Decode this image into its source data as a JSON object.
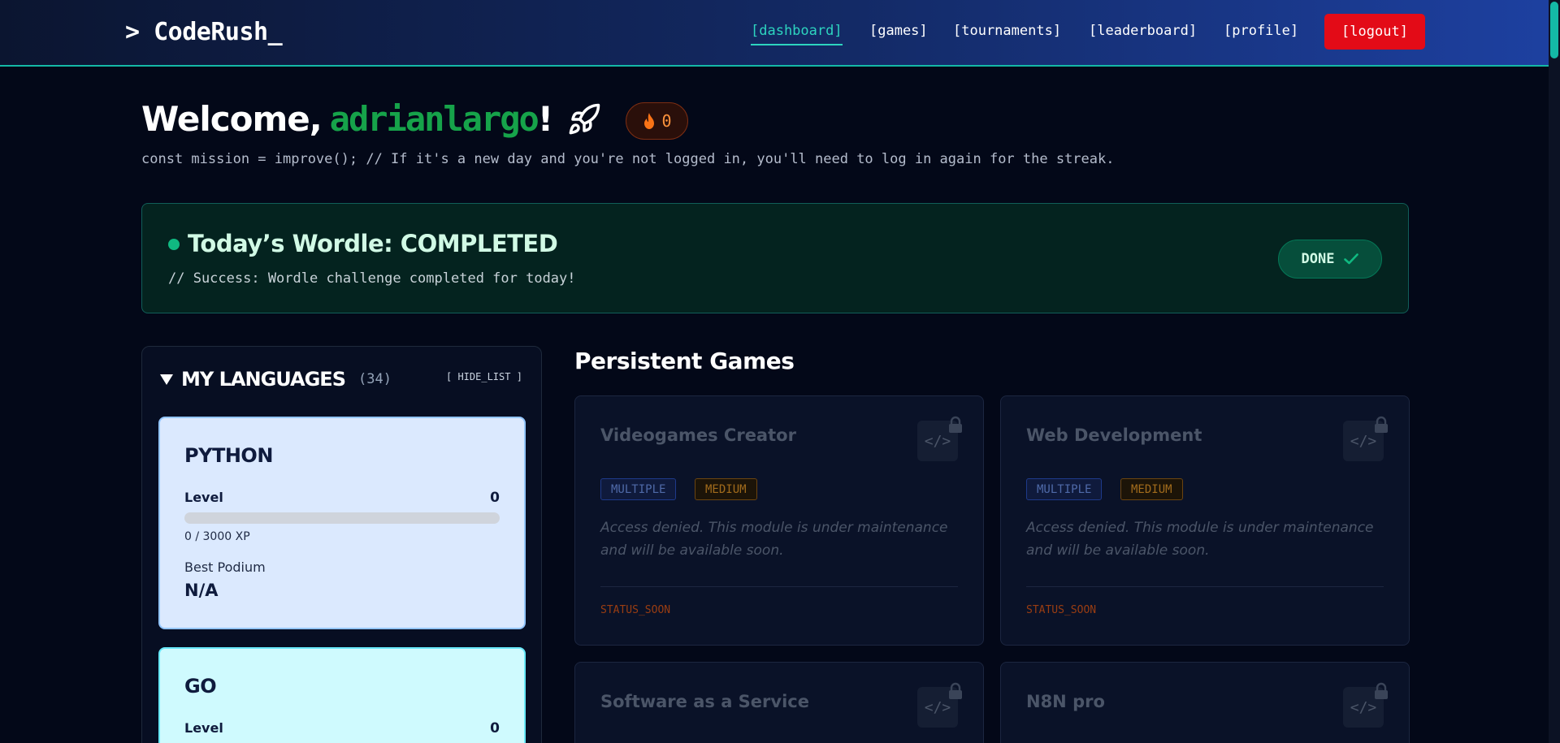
{
  "header": {
    "logo": "> CodeRush_",
    "nav": [
      {
        "label": "[dashboard]",
        "active": true
      },
      {
        "label": "[games]",
        "active": false
      },
      {
        "label": "[tournaments]",
        "active": false
      },
      {
        "label": "[leaderboard]",
        "active": false
      },
      {
        "label": "[profile]",
        "active": false
      }
    ],
    "logout_label": "[logout]"
  },
  "welcome": {
    "prefix": "Welcome,",
    "username": "adrianlargo",
    "suffix": "!",
    "streak": "0",
    "mission": "const mission = improve(); // If it's a new day and you're not logged in, you'll need to log in again for the streak."
  },
  "wordle": {
    "title": "Today’s Wordle: COMPLETED",
    "subtitle": "// Success: Wordle challenge completed for today!",
    "done_label": "DONE"
  },
  "languages": {
    "title": "MY LANGUAGES",
    "count": "(34)",
    "hide_label": "[ HIDE_LIST ]",
    "items": [
      {
        "name": "PYTHON",
        "level_label": "Level",
        "level": "0",
        "xp_text": "0 / 3000 XP",
        "xp_fraction": 0,
        "podium_label": "Best Podium",
        "podium": "N/A"
      },
      {
        "name": "GO",
        "level_label": "Level",
        "level": "0"
      }
    ]
  },
  "games": {
    "title": "Persistent Games",
    "cards": [
      {
        "title": "Videogames Creator",
        "tag1": "MULTIPLE",
        "tag2": "MEDIUM",
        "desc": "Access denied. This module is under maintenance and will be available soon.",
        "status": "STATUS_SOON"
      },
      {
        "title": "Web Development",
        "tag1": "MULTIPLE",
        "tag2": "MEDIUM",
        "desc": "Access denied. This module is under maintenance and will be available soon.",
        "status": "STATUS_SOON"
      },
      {
        "title": "Software as a Service"
      },
      {
        "title": "N8N pro"
      }
    ],
    "code_glyph": "</>"
  },
  "colors": {
    "accent": "#2dd4bf",
    "logout": "#e30b17",
    "username": "#16a34a",
    "success": "#10b981"
  }
}
